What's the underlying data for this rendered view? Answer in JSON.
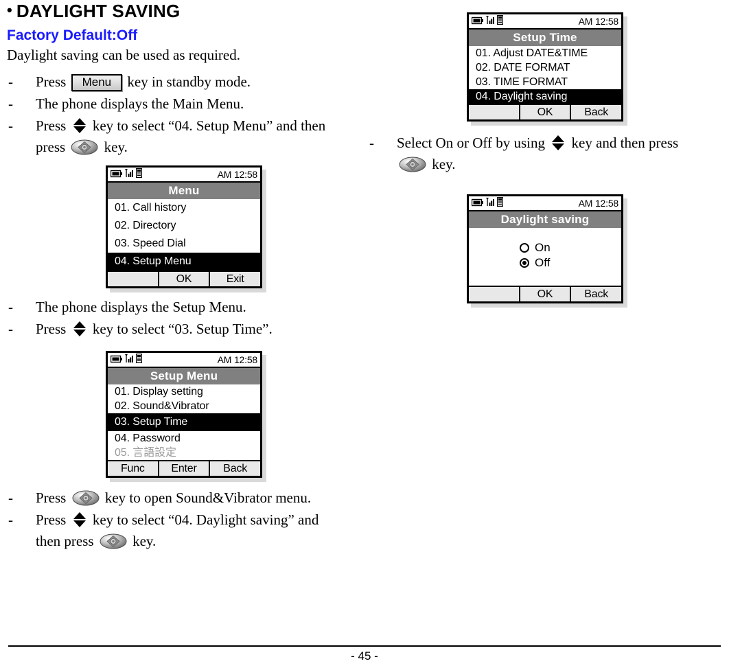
{
  "document": {
    "heading": "DAYLIGHT SAVING",
    "bullet_glyph": "•",
    "factory_default": "Factory Default:Off",
    "factory_default_color": "#1a1aff",
    "intro": "Daylight saving can be used as required.",
    "page_number": "- 45 -"
  },
  "steps_left": {
    "s1_a": "Press",
    "s1_key": "Menu",
    "s1_b": "key in standby mode.",
    "s2": "The phone displays the Main Menu.",
    "s3_a": "Press",
    "s3_b": "key to select “04. Setup Menu” and then",
    "s3_c": "press",
    "s3_d": "key.",
    "s4": "The phone displays the Setup Menu.",
    "s5_a": "Press",
    "s5_b": "key to select “03. Setup Time”.",
    "s6_a": "Press",
    "s6_b": "key to open Sound&Vibrator menu.",
    "s7_a": "Press",
    "s7_b": "key to select “04. Daylight saving” and",
    "s7_c": "then press",
    "s7_d": "key.",
    "dash": "-"
  },
  "steps_right": {
    "s1_a": "Select On or Off by using",
    "s1_b": "key and then press",
    "s1_c": "key.",
    "dash": "-"
  },
  "screens": {
    "main_menu": {
      "clock": "AM 12:58",
      "title": "Menu",
      "items": [
        {
          "label": "01. Call history",
          "selected": false
        },
        {
          "label": "02. Directory",
          "selected": false
        },
        {
          "label": "03. Speed Dial",
          "selected": false
        },
        {
          "label": "04. Setup Menu",
          "selected": true
        }
      ],
      "softkeys": [
        "",
        "OK",
        "Exit"
      ]
    },
    "setup_menu": {
      "clock": "AM 12:58",
      "title": "Setup Menu",
      "items": [
        {
          "label": "01. Display setting",
          "selected": false,
          "dim": false
        },
        {
          "label": "02. Sound&Vibrator",
          "selected": false,
          "dim": false
        },
        {
          "label": "03. Setup Time",
          "selected": true,
          "dim": false
        },
        {
          "label": "04. Password",
          "selected": false,
          "dim": false
        },
        {
          "label": "05. 言語設定",
          "selected": false,
          "dim": true
        }
      ],
      "softkeys": [
        "Func",
        "Enter",
        "Back"
      ]
    },
    "setup_time": {
      "clock": "AM 12:58",
      "title": "Setup Time",
      "items": [
        {
          "label": "01. Adjust DATE&TIME",
          "selected": false
        },
        {
          "label": "02. DATE FORMAT",
          "selected": false
        },
        {
          "label": "03. TIME FORMAT",
          "selected": false
        },
        {
          "label": "04. Daylight saving",
          "selected": true
        }
      ],
      "softkeys": [
        "",
        "OK",
        "Back"
      ]
    },
    "daylight_saving": {
      "clock": "AM 12:58",
      "title": "Daylight saving",
      "options": [
        {
          "label": "On",
          "selected": false
        },
        {
          "label": "Off",
          "selected": true
        }
      ],
      "softkeys": [
        "",
        "OK",
        "Back"
      ]
    }
  },
  "icons": {
    "battery": "battery-icon",
    "signal": "signal-bars-icon",
    "handset": "handset-icon",
    "updown": "up-down-arrow-icon",
    "navkey": "navigation-key-icon"
  }
}
